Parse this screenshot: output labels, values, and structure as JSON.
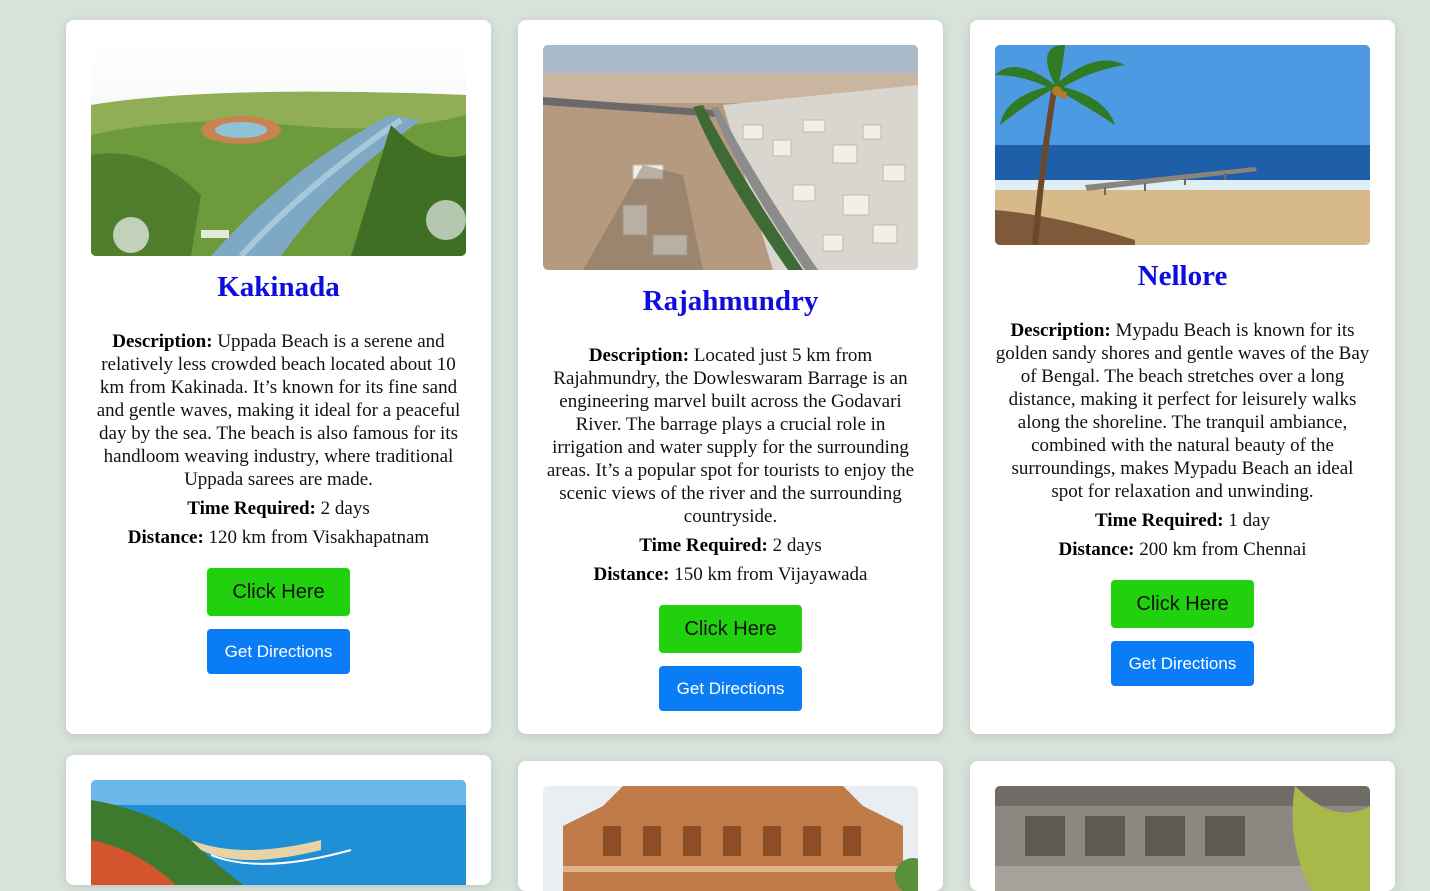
{
  "cards": [
    {
      "title": "Kakinada",
      "desc_label": "Description:",
      "desc": " Uppada Beach is a serene and relatively less crowded beach located about 10 km from Kakinada. It’s known for its fine sand and gentle waves, making it ideal for a peaceful day by the sea. The beach is also famous for its handloom weaving industry, where traditional Uppada sarees are made.",
      "time_label": "Time Required:",
      "time": " 2 days",
      "dist_label": "Distance:",
      "dist": " 120 km from Visakhapatnam",
      "click_label": "Click Here",
      "directions_label": "Get Directions",
      "image_alt": "aerial view of river park with fountains"
    },
    {
      "title": "Rajahmundry",
      "desc_label": "Description:",
      "desc": " Located just 5 km from Rajahmundry, the Dowleswaram Barrage is an engineering marvel built across the Godavari River. The barrage plays a crucial role in irrigation and water supply for the surrounding areas. It’s a popular spot for tourists to enjoy the scenic views of the river and the surrounding countryside.",
      "time_label": "Time Required:",
      "time": " 2 days",
      "dist_label": "Distance:",
      "dist": " 150 km from Vijayawada",
      "click_label": "Click Here",
      "directions_label": "Get Directions",
      "image_alt": "aerial view of city beside Godavari river with bridge"
    },
    {
      "title": "Nellore",
      "desc_label": "Description:",
      "desc": " Mypadu Beach is known for its golden sandy shores and gentle waves of the Bay of Bengal. The beach stretches over a long distance, making it perfect for leisurely walks along the shoreline. The tranquil ambiance, combined with the natural beauty of the surroundings, makes Mypadu Beach an ideal spot for relaxation and unwinding.",
      "time_label": "Time Required:",
      "time": " 1 day",
      "dist_label": "Distance:",
      "dist": " 200 km from Chennai",
      "click_label": "Click Here",
      "directions_label": "Get Directions",
      "image_alt": "beach with palm tree and pier"
    }
  ],
  "colors": {
    "background": "#d7e2da",
    "title": "#0d0de0",
    "click_button": "#21d10e",
    "directions_button": "#0a7cf5"
  }
}
